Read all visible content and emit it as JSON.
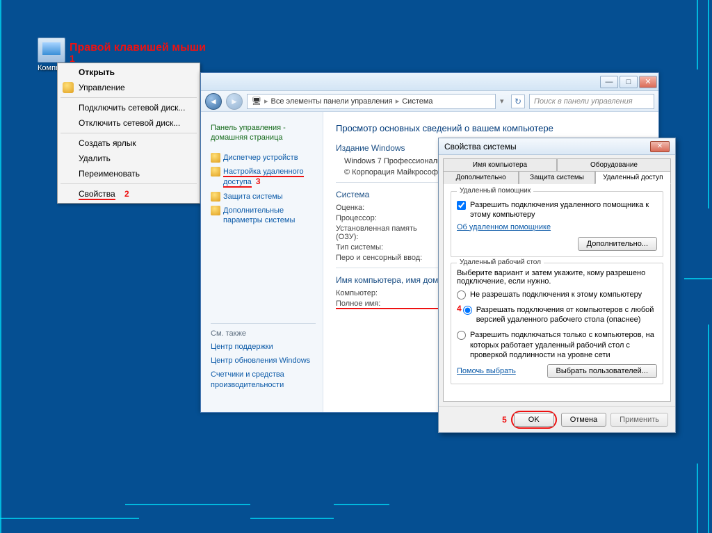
{
  "annotations": {
    "title": "Правой клавишей мыши",
    "n1": "1",
    "n2": "2",
    "n3": "3",
    "n4": "4",
    "n5": "5"
  },
  "desktop": {
    "computer_label": "Компью"
  },
  "context_menu": {
    "open": "Открыть",
    "manage": "Управление",
    "map_drive": "Подключить сетевой диск...",
    "disconnect_drive": "Отключить сетевой диск...",
    "create_shortcut": "Создать ярлык",
    "delete": "Удалить",
    "rename": "Переименовать",
    "properties": "Свойства"
  },
  "window": {
    "breadcrumb_all": "Все элементы панели управления",
    "breadcrumb_system": "Система",
    "search_placeholder": "Поиск в панели управления",
    "side": {
      "home": "Панель управления - домашняя страница",
      "device_mgr": "Диспетчер устройств",
      "remote_settings": "Настройка удаленного доступа",
      "system_protection": "Защита системы",
      "advanced": "Дополнительные параметры системы",
      "see_also": "См. также",
      "action_center": "Центр поддержки",
      "windows_update": "Центр обновления Windows",
      "perf": "Счетчики и средства производительности"
    },
    "main": {
      "heading": "Просмотр основных сведений о вашем компьютере",
      "edition_title": "Издание Windows",
      "edition_value": "Windows 7 Профессиональ",
      "copyright": "© Корпорация Майкрософ защищены.",
      "system_title": "Система",
      "rating": "Оценка:",
      "processor": "Процессор:",
      "ram": "Установленная память (ОЗУ):",
      "systype": "Тип системы:",
      "pen": "Перо и сенсорный ввод:",
      "domain_title": "Имя компьютера, имя домена",
      "computer": "Компьютер:",
      "fullname": "Полное имя:"
    }
  },
  "dialog": {
    "title": "Свойства системы",
    "tabs": {
      "computer_name": "Имя компьютера",
      "hardware": "Оборудование",
      "advanced": "Дополнительно",
      "protection": "Защита системы",
      "remote": "Удаленный доступ"
    },
    "assistant": {
      "group": "Удаленный помощник",
      "allow": "Разрешить подключения удаленного помощника к этому компьютеру",
      "about": "Об удаленном помощнике",
      "more": "Дополнительно..."
    },
    "rdp": {
      "group": "Удаленный рабочий стол",
      "intro": "Выберите вариант и затем укажите, кому разрешено подключение, если нужно.",
      "opt_none": "Не разрешать подключения к этому компьютеру",
      "opt_any": "Разрешать подключения от компьютеров с любой версией удаленного рабочего стола (опаснее)",
      "opt_nla": "Разрешить подключаться только с компьютеров, на которых работает удаленный рабочий стол с проверкой подлинности на уровне сети",
      "help": "Помочь выбрать",
      "select_users": "Выбрать пользователей..."
    },
    "buttons": {
      "ok": "OK",
      "cancel": "Отмена",
      "apply": "Применить"
    }
  }
}
